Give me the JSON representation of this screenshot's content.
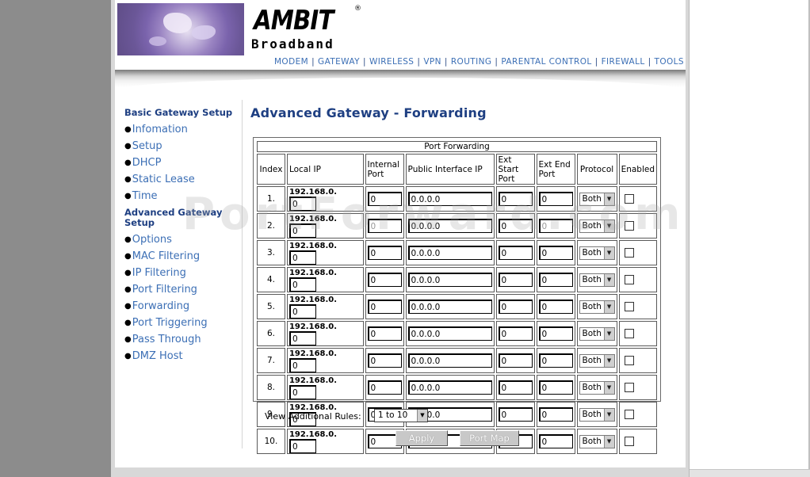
{
  "brand": {
    "name": "AMBIT",
    "reg": "®",
    "tagline": "Broadband"
  },
  "topnav": [
    "MODEM",
    "GATEWAY",
    "WIRELESS",
    "VPN",
    "ROUTING",
    "PARENTAL CONTROL",
    "FIREWALL",
    "TOOLS"
  ],
  "sidebar": {
    "section1": "Basic Gateway Setup",
    "items1": [
      "Infomation",
      "Setup",
      "DHCP",
      "Static Lease",
      "Time"
    ],
    "section2": "Advanced Gateway Setup",
    "items2": [
      "Options",
      "MAC Filtering",
      "IP Filtering",
      "Port Filtering",
      "Forwarding",
      "Port Triggering",
      "Pass Through",
      "DMZ Host"
    ]
  },
  "main": {
    "title": "Advanced Gateway - Forwarding"
  },
  "table": {
    "caption": "Port Forwarding",
    "headers": {
      "index": "Index",
      "local_ip": "Local IP",
      "internal_port": "Internal Port",
      "public_ip": "Public Interface IP",
      "ext_start": "Ext Start Port",
      "ext_end": "Ext End Port",
      "protocol": "Protocol",
      "enabled": "Enabled"
    },
    "ip_prefix": "192.168.0.",
    "rows": [
      {
        "index": "1.",
        "octet": "0",
        "internal_port": "0",
        "public_ip": "0.0.0.0",
        "ext_start": "0",
        "ext_end": "0",
        "protocol": "Both",
        "enabled": false
      },
      {
        "index": "2.",
        "octet": "0",
        "internal_port": "0",
        "public_ip": "0.0.0.0",
        "ext_start": "0",
        "ext_end": "0",
        "protocol": "Both",
        "enabled": false
      },
      {
        "index": "3.",
        "octet": "0",
        "internal_port": "0",
        "public_ip": "0.0.0.0",
        "ext_start": "0",
        "ext_end": "0",
        "protocol": "Both",
        "enabled": false
      },
      {
        "index": "4.",
        "octet": "0",
        "internal_port": "0",
        "public_ip": "0.0.0.0",
        "ext_start": "0",
        "ext_end": "0",
        "protocol": "Both",
        "enabled": false
      },
      {
        "index": "5.",
        "octet": "0",
        "internal_port": "0",
        "public_ip": "0.0.0.0",
        "ext_start": "0",
        "ext_end": "0",
        "protocol": "Both",
        "enabled": false
      },
      {
        "index": "6.",
        "octet": "0",
        "internal_port": "0",
        "public_ip": "0.0.0.0",
        "ext_start": "0",
        "ext_end": "0",
        "protocol": "Both",
        "enabled": false
      },
      {
        "index": "7.",
        "octet": "0",
        "internal_port": "0",
        "public_ip": "0.0.0.0",
        "ext_start": "0",
        "ext_end": "0",
        "protocol": "Both",
        "enabled": false
      },
      {
        "index": "8.",
        "octet": "0",
        "internal_port": "0",
        "public_ip": "0.0.0.0",
        "ext_start": "0",
        "ext_end": "0",
        "protocol": "Both",
        "enabled": false
      },
      {
        "index": "9.",
        "octet": "0",
        "internal_port": "0",
        "public_ip": "0.0.0.0",
        "ext_start": "0",
        "ext_end": "0",
        "protocol": "Both",
        "enabled": false
      },
      {
        "index": "10.",
        "octet": "0",
        "internal_port": "0",
        "public_ip": "0.0.0.0",
        "ext_start": "0",
        "ext_end": "0",
        "protocol": "Both",
        "enabled": false
      }
    ]
  },
  "footer": {
    "view_label": "View Additional Rules:",
    "view_value": "1 to 10",
    "apply": "Apply",
    "port_map": "Port Map"
  },
  "watermark": "PortForward.com",
  "colors": {
    "link": "#3c6fb5",
    "heading": "#1e3f82"
  }
}
